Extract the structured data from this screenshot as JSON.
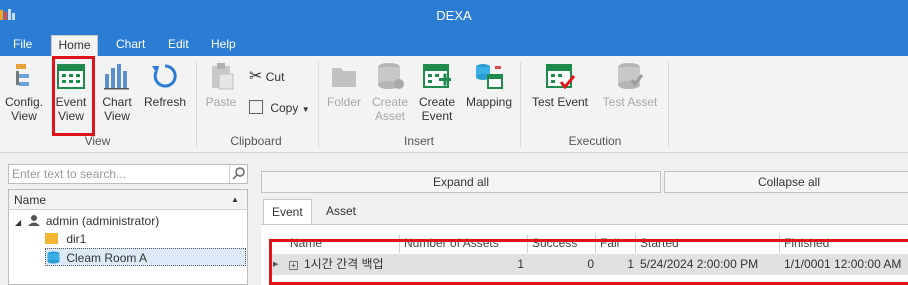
{
  "window": {
    "title": "DEXA"
  },
  "menu_tabs": [
    "File",
    "Home",
    "Chart",
    "Edit",
    "Help"
  ],
  "ribbon": {
    "view": {
      "config_view": [
        "Config.",
        "View"
      ],
      "event_view": [
        "Event",
        "View"
      ],
      "chart_view": [
        "Chart",
        "View"
      ],
      "refresh": "Refresh",
      "group_label": "View"
    },
    "clipboard": {
      "paste": "Paste",
      "cut": "Cut",
      "copy": "Copy",
      "group_label": "Clipboard"
    },
    "insert": {
      "folder": "Folder",
      "create_asset": [
        "Create",
        "Asset"
      ],
      "create_event": [
        "Create",
        "Event"
      ],
      "mapping": "Mapping",
      "group_label": "Insert"
    },
    "execution": {
      "test_event": "Test Event",
      "test_asset": "Test Asset",
      "group_label": "Execution"
    }
  },
  "left_pane": {
    "search_placeholder": "Enter text to search...",
    "tree_header": "Name",
    "nodes": [
      {
        "label": "admin (administrator)",
        "icon": "user-icon"
      },
      {
        "label": "dir1",
        "icon": "folder-icon"
      },
      {
        "label": "Cleam Room A",
        "icon": "database-icon"
      }
    ]
  },
  "right_pane": {
    "expand_all": "Expand all",
    "collapse_all": "Collapse all",
    "tabs": [
      "Event",
      "Asset"
    ],
    "grid": {
      "columns": [
        "Name",
        "Number of Assets",
        "Success",
        "Fail",
        "Started",
        "Finished"
      ],
      "rows": [
        {
          "name": "1시간 간격 백업",
          "assets": "1",
          "success": "0",
          "fail": "1",
          "started": "5/24/2024 2:00:00 PM",
          "finished": "1/1/0001 12:00:00 AM"
        }
      ]
    }
  },
  "colors": {
    "accent": "#2b7cd3",
    "highlight": "#e0151b",
    "green": "#1e8a4c"
  }
}
